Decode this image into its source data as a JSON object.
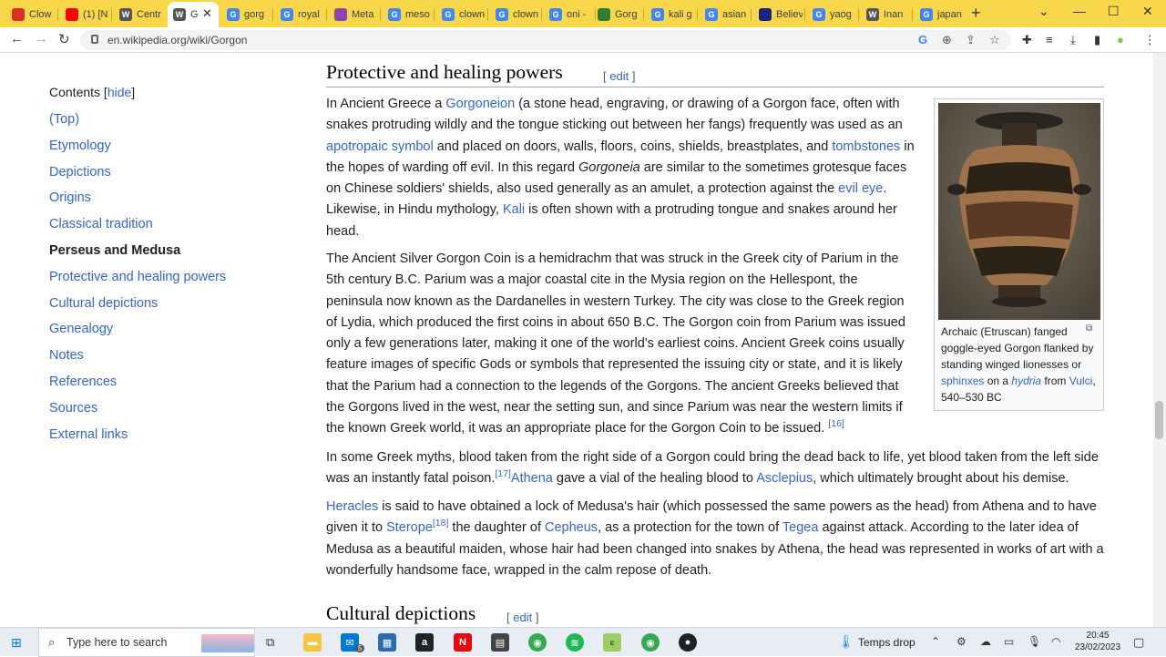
{
  "browser": {
    "tabs": [
      {
        "label": "Clow",
        "icon": "gmail-icon",
        "color": "#d93025"
      },
      {
        "label": "(1) [N",
        "icon": "youtube-icon",
        "color": "#ff0000"
      },
      {
        "label": "Centr",
        "icon": "wikipedia-icon",
        "color": "#555555"
      },
      {
        "label": "G",
        "icon": "wikipedia-icon",
        "color": "#555555"
      },
      {
        "label": "gorg",
        "icon": "google-icon",
        "color": "#4285f4"
      },
      {
        "label": "royal",
        "icon": "google-icon",
        "color": "#4285f4"
      },
      {
        "label": "Meta",
        "icon": "meta-icon",
        "color": "#8e44ad"
      },
      {
        "label": "meso",
        "icon": "google-icon",
        "color": "#4285f4"
      },
      {
        "label": "clown",
        "icon": "google-icon",
        "color": "#4285f4"
      },
      {
        "label": "clown",
        "icon": "google-icon",
        "color": "#4285f4"
      },
      {
        "label": "oni -",
        "icon": "google-icon",
        "color": "#4285f4"
      },
      {
        "label": "Gorg",
        "icon": "globe-icon",
        "color": "#2e7d32"
      },
      {
        "label": "kali g",
        "icon": "google-icon",
        "color": "#4285f4"
      },
      {
        "label": "asian",
        "icon": "google-icon",
        "color": "#4285f4"
      },
      {
        "label": "Believ",
        "icon": "brand-icon",
        "color": "#1a237e"
      },
      {
        "label": "yaog",
        "icon": "google-icon",
        "color": "#4285f4"
      },
      {
        "label": "Inan",
        "icon": "wikipedia-icon",
        "color": "#555555"
      },
      {
        "label": "japan",
        "icon": "google-icon",
        "color": "#4285f4"
      }
    ],
    "url": "en.wikipedia.org/wiki/Gorgon"
  },
  "toc": {
    "title": "Contents",
    "hide": "hide",
    "items": [
      {
        "label": "(Top)"
      },
      {
        "label": "Etymology"
      },
      {
        "label": "Depictions"
      },
      {
        "label": "Origins"
      },
      {
        "label": "Classical tradition"
      },
      {
        "label": "Perseus and Medusa",
        "current": true
      },
      {
        "label": "Protective and healing powers"
      },
      {
        "label": "Cultural depictions"
      },
      {
        "label": "Genealogy"
      },
      {
        "label": "Notes"
      },
      {
        "label": "References"
      },
      {
        "label": "Sources"
      },
      {
        "label": "External links"
      }
    ]
  },
  "section1": {
    "heading": "Protective and healing powers",
    "edit": "edit",
    "p1": {
      "t1": "In Ancient Greece a ",
      "l1": "Gorgoneion",
      "t2": " (a stone head, engraving, or drawing of a Gorgon face, often with snakes protruding wildly and the tongue sticking out between her fangs) frequently was used as an ",
      "l2": "apotropaic symbol",
      "t3": " and placed on doors, walls, floors, coins, shields, breastplates, and ",
      "l3": "tombstones",
      "t4": " in the hopes of warding off evil. In this regard ",
      "i1": "Gorgoneia",
      "t5": " are similar to the sometimes grotesque faces on Chinese soldiers' shields, also used generally as an amulet, a protection against the ",
      "l4": "evil eye",
      "t6": ". Likewise, in Hindu mythology, ",
      "l5": "Kali",
      "t7": " is often shown with a protruding tongue and snakes around her head."
    },
    "p2": {
      "t1": "The Ancient Silver Gorgon Coin is a hemidrachm that was struck in the Greek city of Parium in the 5th century B.C. Parium was a major coastal cite in the Mysia region on the Hellespont, the peninsula now known as the Dardanelles in western Turkey. The city was close to the Greek region of Lydia, which produced the first coins in about 650 B.C. The Gorgon coin from Parium was issued only a few generations later, making it one of the world's earliest coins. Ancient Greek coins usually feature images of specific Gods or symbols that represented the issuing city or state, and it is likely that the Parium had a connection to the legends of the Gorgons. The ancient Greeks believed that the Gorgons lived in the west, near the setting sun, and since Parium was near the western limits if the known Greek world, it was an appropriate place for the Gorgon Coin to be issued. ",
      "ref": "[16]"
    },
    "p3": {
      "t1": "In some Greek myths, blood taken from the right side of a Gorgon could bring the dead back to life, yet blood taken from the left side was an instantly fatal poison.",
      "ref": "[17]",
      "l1": "Athena",
      "t2": " gave a vial of the healing blood to ",
      "l2": "Asclepius",
      "t3": ", which ultimately brought about his demise."
    },
    "p4": {
      "l1": "Heracles",
      "t1": " is said to have obtained a lock of Medusa's hair (which possessed the same powers as the head) from Athena and to have given it to ",
      "l2": "Sterope",
      "ref": "[18]",
      "t2": " the daughter of ",
      "l3": "Cepheus",
      "t3": ", as a protection for the town of ",
      "l4": "Tegea",
      "t4": " against attack. According to the later idea of Medusa as a beautiful maiden, whose hair had been changed into snakes by Athena, the head was represented in works of art with a wonderfully handsome face, wrapped in the calm repose of death."
    }
  },
  "thumb": {
    "t1": "Archaic (Etruscan) fanged goggle-eyed Gorgon flanked by standing winged lionesses or ",
    "l1": "sphinxes",
    "t2": " on a ",
    "l2": "hydria",
    "t3": " from ",
    "l3": "Vulci",
    "t4": ", 540–530 BC"
  },
  "section2": {
    "heading": "Cultural depictions",
    "edit": "edit"
  },
  "taskbar": {
    "search_placeholder": "Type here to search",
    "weather": "Temps drop",
    "time": "20:45",
    "date": "23/02/2023",
    "mail_badge": "5"
  }
}
